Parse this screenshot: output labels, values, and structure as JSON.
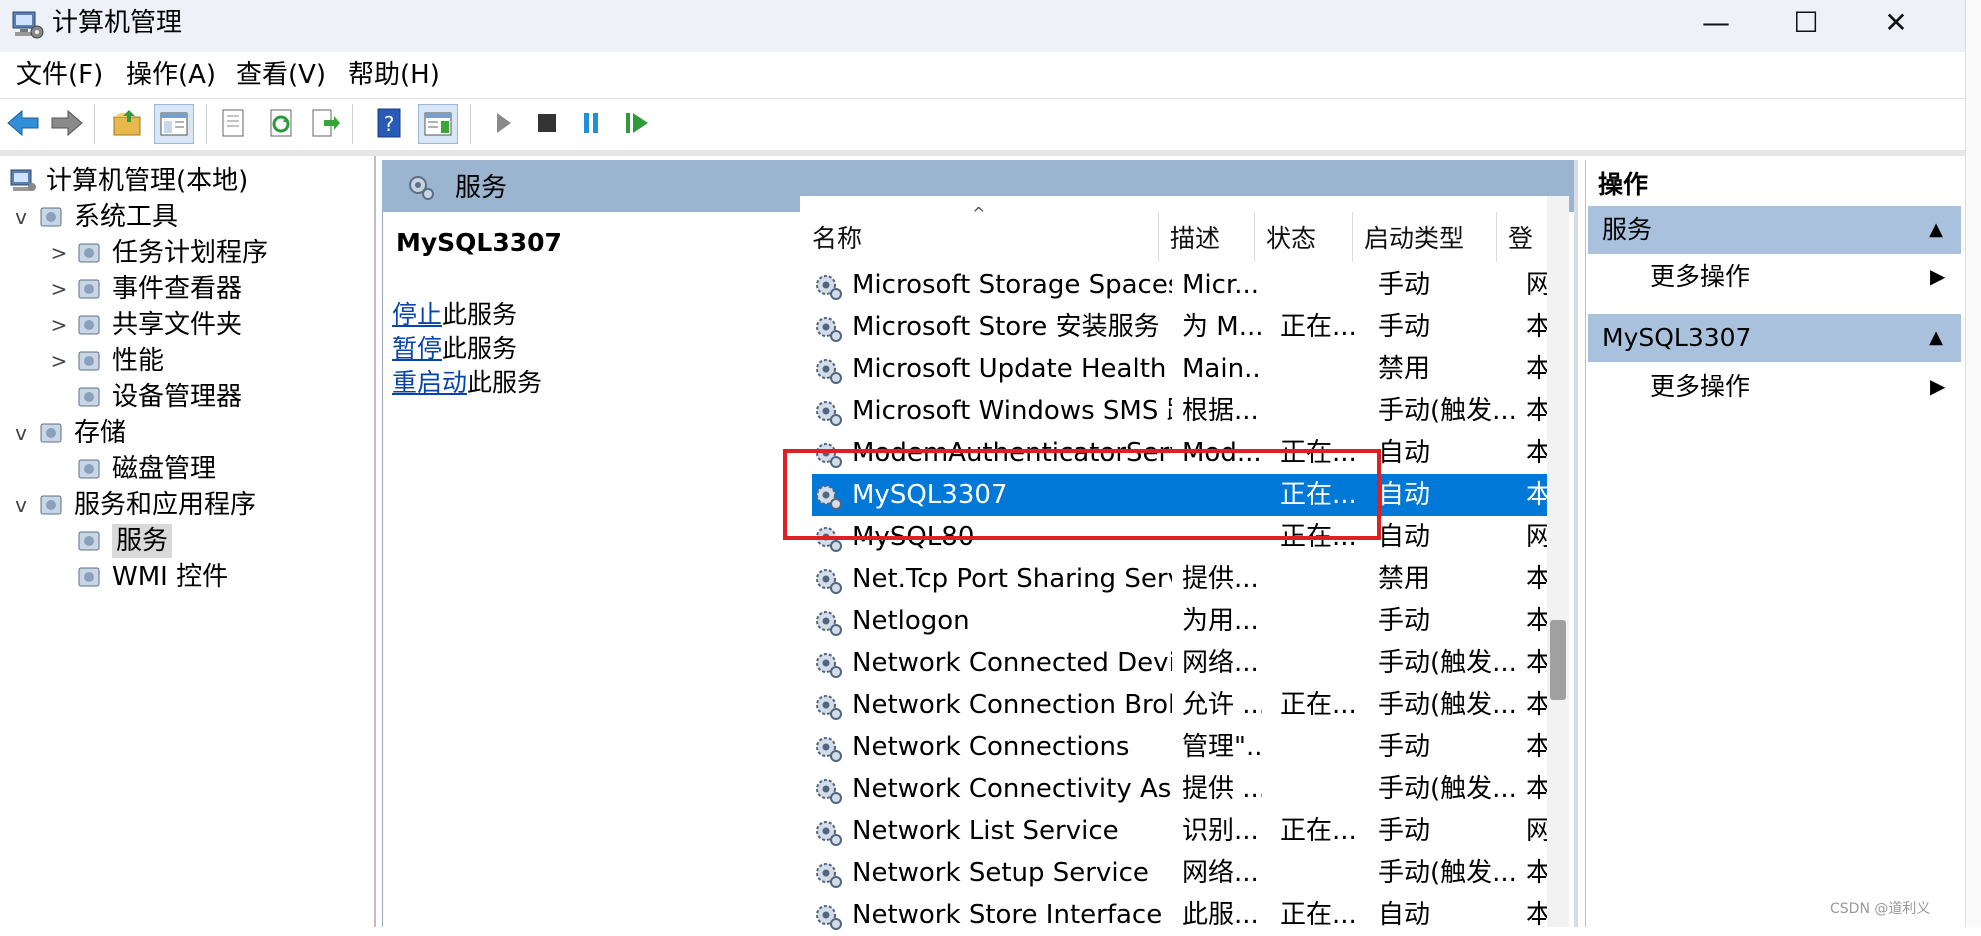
{
  "window": {
    "title": "计算机管理",
    "minimize": "—",
    "maximize": "☐",
    "close": "✕"
  },
  "menu": [
    "文件(F)",
    "操作(A)",
    "查看(V)",
    "帮助(H)"
  ],
  "toolbar": [
    "back-arrow",
    "forward-arrow",
    "up-folder",
    "show-tree",
    "properties",
    "refresh",
    "export-list",
    "help",
    "show-action-pane",
    "start-service",
    "stop-service",
    "pause-service",
    "resume-service"
  ],
  "tree": {
    "root": "计算机管理(本地)",
    "items": [
      {
        "label": "系统工具",
        "level": 1,
        "expand": "v"
      },
      {
        "label": "任务计划程序",
        "level": 2,
        "expand": ">"
      },
      {
        "label": "事件查看器",
        "level": 2,
        "expand": ">"
      },
      {
        "label": "共享文件夹",
        "level": 2,
        "expand": ">"
      },
      {
        "label": "性能",
        "level": 2,
        "expand": ">"
      },
      {
        "label": "设备管理器",
        "level": 2,
        "expand": ""
      },
      {
        "label": "存储",
        "level": 1,
        "expand": "v"
      },
      {
        "label": "磁盘管理",
        "level": 2,
        "expand": ""
      },
      {
        "label": "服务和应用程序",
        "level": 1,
        "expand": "v"
      },
      {
        "label": "服务",
        "level": 2,
        "expand": "",
        "selected": true
      },
      {
        "label": "WMI 控件",
        "level": 2,
        "expand": ""
      }
    ]
  },
  "center": {
    "header": "服务",
    "detail_title": "MySQL3307",
    "actions": [
      {
        "link": "停止",
        "rest": "此服务"
      },
      {
        "link": "暂停",
        "rest": "此服务"
      },
      {
        "link": "重启动",
        "rest": "此服务"
      }
    ],
    "sort_indicator": "^",
    "columns": [
      "名称",
      "描述",
      "状态",
      "启动类型",
      "登"
    ],
    "rows": [
      {
        "name": "Microsoft Storage Spaces S...",
        "desc": "Micr...",
        "state": "",
        "start": "手动",
        "logon": "网"
      },
      {
        "name": "Microsoft Store 安装服务",
        "desc": "为 M...",
        "state": "正在...",
        "start": "手动",
        "logon": "本"
      },
      {
        "name": "Microsoft Update Health S...",
        "desc": "Main...",
        "state": "",
        "start": "禁用",
        "logon": "本"
      },
      {
        "name": "Microsoft Windows SMS 路...",
        "desc": "根据...",
        "state": "",
        "start": "手动(触发...",
        "logon": "本"
      },
      {
        "name": "ModemAuthenticatorServi...",
        "desc": "Mod...",
        "state": "正在...",
        "start": "自动",
        "logon": "本"
      },
      {
        "name": "MySQL3307",
        "desc": "",
        "state": "正在...",
        "start": "自动",
        "logon": "本",
        "selected": true
      },
      {
        "name": "MySQL80",
        "desc": "",
        "state": "正在...",
        "start": "自动",
        "logon": "网"
      },
      {
        "name": "Net.Tcp Port Sharing Service",
        "desc": "提供...",
        "state": "",
        "start": "禁用",
        "logon": "本"
      },
      {
        "name": "Netlogon",
        "desc": "为用...",
        "state": "",
        "start": "手动",
        "logon": "本"
      },
      {
        "name": "Network Connected Devic...",
        "desc": "网络...",
        "state": "",
        "start": "手动(触发...",
        "logon": "本"
      },
      {
        "name": "Network Connection Broker",
        "desc": "允许 ...",
        "state": "正在...",
        "start": "手动(触发...",
        "logon": "本"
      },
      {
        "name": "Network Connections",
        "desc": "管理\"...",
        "state": "",
        "start": "手动",
        "logon": "本"
      },
      {
        "name": "Network Connectivity Assis...",
        "desc": "提供 ...",
        "state": "",
        "start": "手动(触发...",
        "logon": "本"
      },
      {
        "name": "Network List Service",
        "desc": "识别...",
        "state": "正在...",
        "start": "手动",
        "logon": "网"
      },
      {
        "name": "Network Setup Service",
        "desc": "网络...",
        "state": "",
        "start": "手动(触发...",
        "logon": "本"
      },
      {
        "name": "Network Store Interface Se...",
        "desc": "此服...",
        "state": "正在...",
        "start": "自动",
        "logon": "本"
      }
    ]
  },
  "actions_pane": {
    "title": "操作",
    "sections": [
      {
        "title": "服务",
        "item": "更多操作"
      },
      {
        "title": "MySQL3307",
        "item": "更多操作"
      }
    ]
  },
  "watermark": "CSDN @道利义",
  "colors": {
    "selection": "#0078d7",
    "header": "#9bb4cf",
    "annotation": "#e02020"
  }
}
